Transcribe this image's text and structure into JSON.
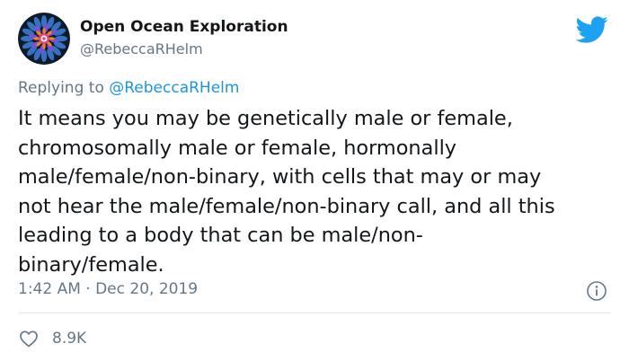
{
  "author": {
    "display_name": "Open Ocean Exploration",
    "handle": "@RebeccaRHelm"
  },
  "reply": {
    "prefix": "Replying to",
    "mention": "@RebeccaRHelm"
  },
  "tweet": {
    "lines": [
      "It means you may be genetically male or female,",
      "chromosomally male or female, hormonally",
      "male/female/non-binary, with cells that may or may",
      "not hear the male/female/non-binary call, and all this",
      "leading to a body that can be male/non-",
      "binary/female."
    ]
  },
  "meta": {
    "timestamp": "1:42 AM · Dec 20, 2019"
  },
  "actions": {
    "likes": "8.9K"
  },
  "icons": {
    "brand": "twitter-bird-icon",
    "info": "info-icon",
    "like": "heart-icon"
  },
  "colors": {
    "text": "#14171a",
    "secondary": "#657786",
    "accent": "#1b95e0",
    "twitter_blue": "#1da1f2",
    "divider": "#e1e8ed"
  }
}
